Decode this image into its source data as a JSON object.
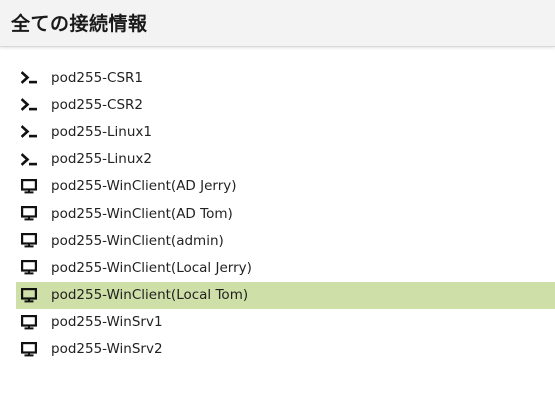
{
  "header": {
    "title": "全ての接続情報"
  },
  "connections": [
    {
      "name": "pod255-CSR1",
      "icon": "terminal-icon",
      "selected": false
    },
    {
      "name": "pod255-CSR2",
      "icon": "terminal-icon",
      "selected": false
    },
    {
      "name": "pod255-Linux1",
      "icon": "terminal-icon",
      "selected": false
    },
    {
      "name": "pod255-Linux2",
      "icon": "terminal-icon",
      "selected": false
    },
    {
      "name": "pod255-WinClient(AD Jerry)",
      "icon": "monitor-icon",
      "selected": false
    },
    {
      "name": "pod255-WinClient(AD Tom)",
      "icon": "monitor-icon",
      "selected": false
    },
    {
      "name": "pod255-WinClient(admin)",
      "icon": "monitor-icon",
      "selected": false
    },
    {
      "name": "pod255-WinClient(Local Jerry)",
      "icon": "monitor-icon",
      "selected": false
    },
    {
      "name": "pod255-WinClient(Local Tom)",
      "icon": "monitor-icon",
      "selected": true
    },
    {
      "name": "pod255-WinSrv1",
      "icon": "monitor-icon",
      "selected": false
    },
    {
      "name": "pod255-WinSrv2",
      "icon": "monitor-icon",
      "selected": false
    }
  ],
  "colors": {
    "selected_background": "#cfdfa8",
    "header_background": "#f3f3f3"
  }
}
